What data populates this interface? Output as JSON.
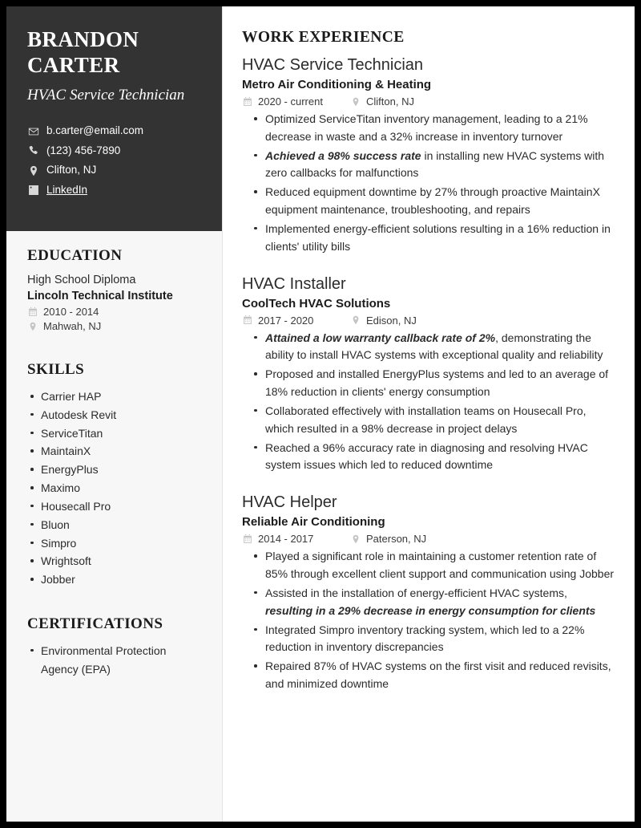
{
  "header": {
    "name_line1": "BRANDON",
    "name_line2": "CARTER",
    "title": "HVAC Service Technician",
    "contacts": [
      {
        "icon": "envelope-icon",
        "text": "b.carter@email.com",
        "link": false
      },
      {
        "icon": "phone-icon",
        "text": "(123) 456-7890",
        "link": false
      },
      {
        "icon": "location-pin-icon",
        "text": "Clifton, NJ",
        "link": false
      },
      {
        "icon": "linkedin-icon",
        "text": "LinkedIn",
        "link": true
      }
    ]
  },
  "sidebar": {
    "education": {
      "heading": "EDUCATION",
      "degree": "High School Diploma",
      "school": "Lincoln Technical Institute",
      "dates": "2010 - 2014",
      "location": "Mahwah, NJ"
    },
    "skills": {
      "heading": "SKILLS",
      "items": [
        "Carrier HAP",
        "Autodesk Revit",
        "ServiceTitan",
        "MaintainX",
        "EnergyPlus",
        "Maximo",
        "Housecall Pro",
        "Bluon",
        "Simpro",
        "Wrightsoft",
        "Jobber"
      ]
    },
    "certifications": {
      "heading": "CERTIFICATIONS",
      "items": [
        "Environmental Protection Agency (EPA)"
      ]
    }
  },
  "main": {
    "heading": "WORK EXPERIENCE",
    "jobs": [
      {
        "title": "HVAC Service Technician",
        "company": "Metro Air Conditioning & Heating",
        "dates": "2020 - current",
        "location": "Clifton, NJ",
        "bullets": [
          {
            "pre": "",
            "em": "",
            "post": "Optimized ServiceTitan inventory management, leading to a 21% decrease in waste and a 32% increase in inventory turnover"
          },
          {
            "pre": "",
            "em": "Achieved a 98% success rate",
            "post": " in installing new HVAC systems with zero callbacks for malfunctions"
          },
          {
            "pre": "",
            "em": "",
            "post": "Reduced equipment downtime by 27% through proactive MaintainX equipment maintenance, troubleshooting, and repairs"
          },
          {
            "pre": "",
            "em": "",
            "post": "Implemented energy-efficient solutions resulting in a 16% reduction in clients' utility bills"
          }
        ]
      },
      {
        "title": "HVAC Installer",
        "company": "CoolTech HVAC Solutions",
        "dates": "2017 - 2020",
        "location": "Edison, NJ",
        "bullets": [
          {
            "pre": "",
            "em": "Attained a low warranty callback rate of 2%",
            "post": ", demonstrating the ability to install HVAC systems with exceptional quality and reliability"
          },
          {
            "pre": "",
            "em": "",
            "post": "Proposed and installed EnergyPlus systems and led to an average of 18% reduction in clients' energy consumption"
          },
          {
            "pre": "",
            "em": "",
            "post": "Collaborated effectively with installation teams on Housecall Pro, which resulted in a 98% decrease in project delays"
          },
          {
            "pre": "",
            "em": "",
            "post": "Reached a 96% accuracy rate in diagnosing and resolving HVAC system issues which led to reduced downtime"
          }
        ]
      },
      {
        "title": "HVAC Helper",
        "company": "Reliable Air Conditioning",
        "dates": "2014 - 2017",
        "location": "Paterson, NJ",
        "bullets": [
          {
            "pre": "",
            "em": "",
            "post": "Played a significant role in maintaining a customer retention rate of 85% through excellent client support and communication using Jobber"
          },
          {
            "pre": "Assisted in the installation of energy-efficient HVAC systems, ",
            "em": "resulting in a 29% decrease in energy consumption for clients",
            "post": ""
          },
          {
            "pre": "",
            "em": "",
            "post": "Integrated Simpro inventory tracking system, which led to a 22% reduction in inventory discrepancies"
          },
          {
            "pre": "",
            "em": "",
            "post": "Repaired 87% of HVAC systems on the first visit and reduced revisits, and minimized downtime"
          }
        ]
      }
    ]
  },
  "colors": {
    "hero_background": "#333333",
    "sidebar_background": "#f7f7f7",
    "page_background": "#ffffff",
    "frame": "#000000",
    "text_primary": "#2b2b2b",
    "icon_muted": "#c4c4c4"
  }
}
